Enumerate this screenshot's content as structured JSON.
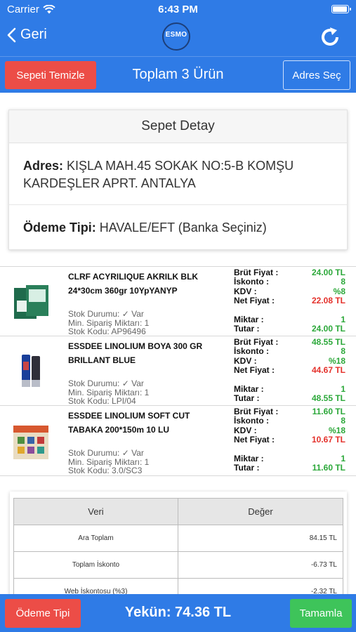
{
  "status_bar": {
    "carrier": "Carrier",
    "time": "6:43 PM",
    "battery_level": 0.95
  },
  "nav": {
    "back_label": "Geri",
    "logo_text": "ESMO"
  },
  "action_bar": {
    "clear_label": "Sepeti Temizle",
    "title": "Toplam 3 Ürün",
    "address_label": "Adres Seç"
  },
  "detail": {
    "header": "Sepet Detay",
    "address_label": "Adres:",
    "address_value": "KIŞLA MAH.45 SOKAK NO:5-B KOMŞU KARDEŞLER APRT. ANTALYA",
    "payment_label": "Ödeme Tipi:",
    "payment_value": "HAVALE/EFT (Banka Seçiniz)"
  },
  "price_labels": {
    "gross": "Brüt Fiyat :",
    "discount": "İskonto :",
    "kdv": "KDV :",
    "net": "Net Fiyat :",
    "qty": "Miktar :",
    "amount": "Tutar :"
  },
  "products": [
    {
      "name": "CLRF ACYRILIQUE AKRILK BLK 24*30cm 360gr 10YpYANYP",
      "stock": "Stok Durumu: ✓ Var",
      "min_order": "Min. Sipariş Miktarı: 1",
      "code": "Stok Kodu: AP96496",
      "gross": "24.00 TL",
      "discount": "8",
      "kdv": "%8",
      "net": "22.08 TL",
      "qty": "1",
      "amount": "24.00 TL"
    },
    {
      "name": "ESSDEE LINOLIUM BOYA 300 GR BRILLANT BLUE",
      "stock": "Stok Durumu: ✓ Var",
      "min_order": "Min. Sipariş Miktarı: 1",
      "code": "Stok Kodu: LPI/04",
      "gross": "48.55 TL",
      "discount": "8",
      "kdv": "%18",
      "net": "44.67 TL",
      "qty": "1",
      "amount": "48.55 TL"
    },
    {
      "name": "ESSDEE LINOLIUM SOFT CUT TABAKA 200*150m 10 LU",
      "stock": "Stok Durumu: ✓ Var",
      "min_order": "Min. Sipariş Miktarı: 1",
      "code": "Stok Kodu: 3.0/SC3",
      "gross": "11.60 TL",
      "discount": "8",
      "kdv": "%18",
      "net": "10.67 TL",
      "qty": "1",
      "amount": "11.60 TL"
    }
  ],
  "totals": {
    "col_key": "Veri",
    "col_value": "Değer",
    "rows": [
      {
        "key": "Ara Toplam",
        "value": "84.15 TL"
      },
      {
        "key": "Toplam İskonto",
        "value": "-6.73 TL"
      },
      {
        "key": "Web İskontosu (%3)",
        "value": "-2.32 TL"
      }
    ]
  },
  "bottom_bar": {
    "payment_label": "Ödeme Tipi",
    "grand_total": "Yekün: 74.36 TL",
    "done_label": "Tamamla"
  },
  "colors": {
    "primary": "#2f7be6",
    "danger": "#ec4d47",
    "success": "#3ec45a",
    "price_green": "#2ca83a",
    "price_red": "#e4312b"
  }
}
